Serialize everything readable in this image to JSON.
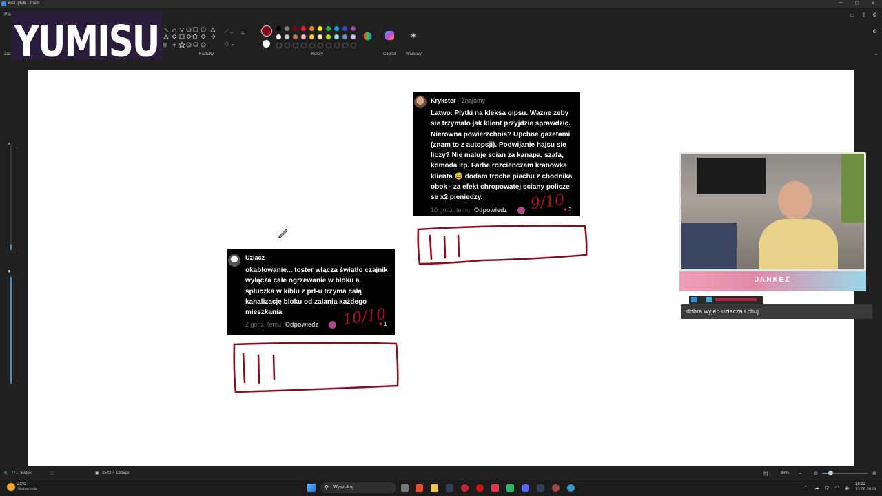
{
  "window": {
    "title": "Bez tytułu - Paint"
  },
  "ribbon": {
    "menu_file": "Plik",
    "shapes_label": "Kształty",
    "colors_label": "Kolory",
    "copilot_label": "Copilot",
    "layers_label": "Warstwy",
    "left_label": "Zaz"
  },
  "overlay": {
    "logo_text": "YUMISU"
  },
  "palette": {
    "row1": [
      "#000000",
      "#7f7f7f",
      "#880015",
      "#ed1c24",
      "#ff7f27",
      "#fff200",
      "#22b14c",
      "#00a2e8",
      "#3f48cc",
      "#a349a4"
    ],
    "row2": [
      "#ffffff",
      "#c3c3c3",
      "#b97a57",
      "#ffaec9",
      "#ffc90e",
      "#efe4b0",
      "#b5e61d",
      "#99d9ea",
      "#7092be",
      "#c8bfe7"
    ],
    "active_primary": "#880015",
    "active_secondary": "#ffffff"
  },
  "comments": [
    {
      "author": "Krykster",
      "relation": " · Znajomy",
      "lines": [
        "Latwo. Plytki na kleksa gipsu. Wazne zeby",
        "sie trzymalo jak klient przyjdzie sprawdzic.",
        "Nierowna powierzchnia? Upchne gazetami",
        "(znam to z autopsji). Podwijanie hajsu sie",
        "liczy? Nie maluje scian za kanapa, szafa,",
        "komoda itp. Farbe rozcienczam kranowka",
        "klienta 😅 dodam troche piachu z chodnika",
        "obok - za efekt chropowatej sciany policze",
        "se x2 pieniedzy."
      ],
      "time": "10 godz. temu",
      "reply": "Odpowiedz",
      "likes": "3",
      "score": "9/10"
    },
    {
      "author": "Uziacz",
      "relation": "",
      "lines": [
        "okablowanie... toster włącza światło czajnik",
        "wyłącza całe ogrzewanie w bloku a",
        "spłuczka w kiblu z prl-u trzyma całą",
        "kanalizację bloku od zalania każdego",
        "mieszkania"
      ],
      "time": "2 godz. temu",
      "reply": "Odpowiedz",
      "likes": "1",
      "score": "10/10"
    }
  ],
  "webcam": {
    "name": "JANKEZ"
  },
  "chat": {
    "message": "dobra wyjeb uziacza i chuj"
  },
  "statusbar": {
    "cursor_pos": "777, 508px",
    "canvas_size": "2542 × 1925px",
    "zoom": "94%"
  },
  "taskbar": {
    "weather_temp": "23°C",
    "weather_desc": "Słonecznie",
    "search_placeholder": "Wyszukaj",
    "time": "18:22",
    "date": "13.08.2026"
  }
}
